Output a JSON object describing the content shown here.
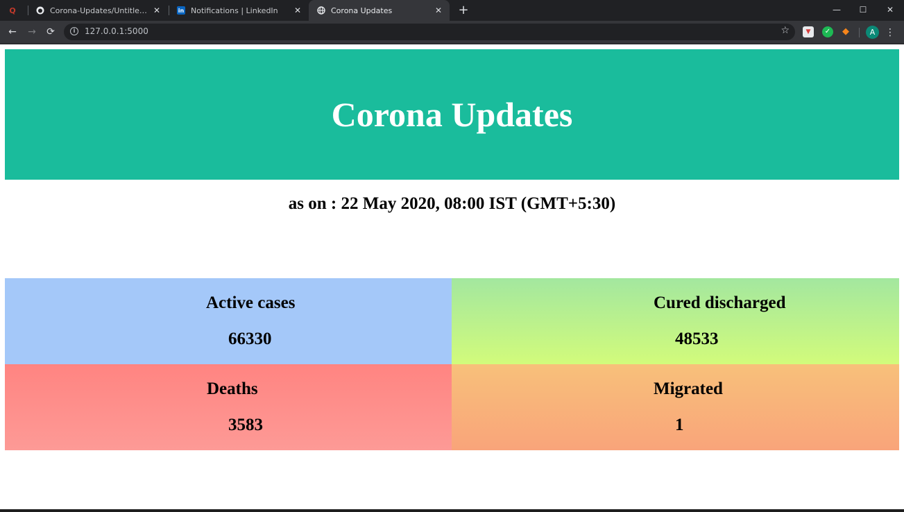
{
  "browser": {
    "tabs": [
      {
        "title": "",
        "icon": "quora-icon"
      },
      {
        "title": "Corona-Updates/Untitled.png at",
        "icon": "github-icon"
      },
      {
        "title": "Notifications | LinkedIn",
        "icon": "linkedin-icon"
      },
      {
        "title": "Corona Updates",
        "icon": "globe-icon",
        "active": true
      }
    ],
    "url": "127.0.0.1:5000",
    "profile_initial": "A",
    "extension_badge": "0"
  },
  "page": {
    "title": "Corona Updates",
    "as_on": "as on : 22 May 2020, 08:00 IST (GMT+5:30)",
    "stats": {
      "active": {
        "label": "Active cases",
        "value": "66330",
        "color": "#a4c8f9"
      },
      "cured": {
        "label": "Cured discharged",
        "value": "48533",
        "color": "#c1f284"
      },
      "deaths": {
        "label": "Deaths",
        "value": "3583",
        "color": "#fe8c88"
      },
      "migrated": {
        "label": "Migrated",
        "value": "1",
        "color": "#f9b27a"
      }
    },
    "header_color": "#1abc9c"
  }
}
